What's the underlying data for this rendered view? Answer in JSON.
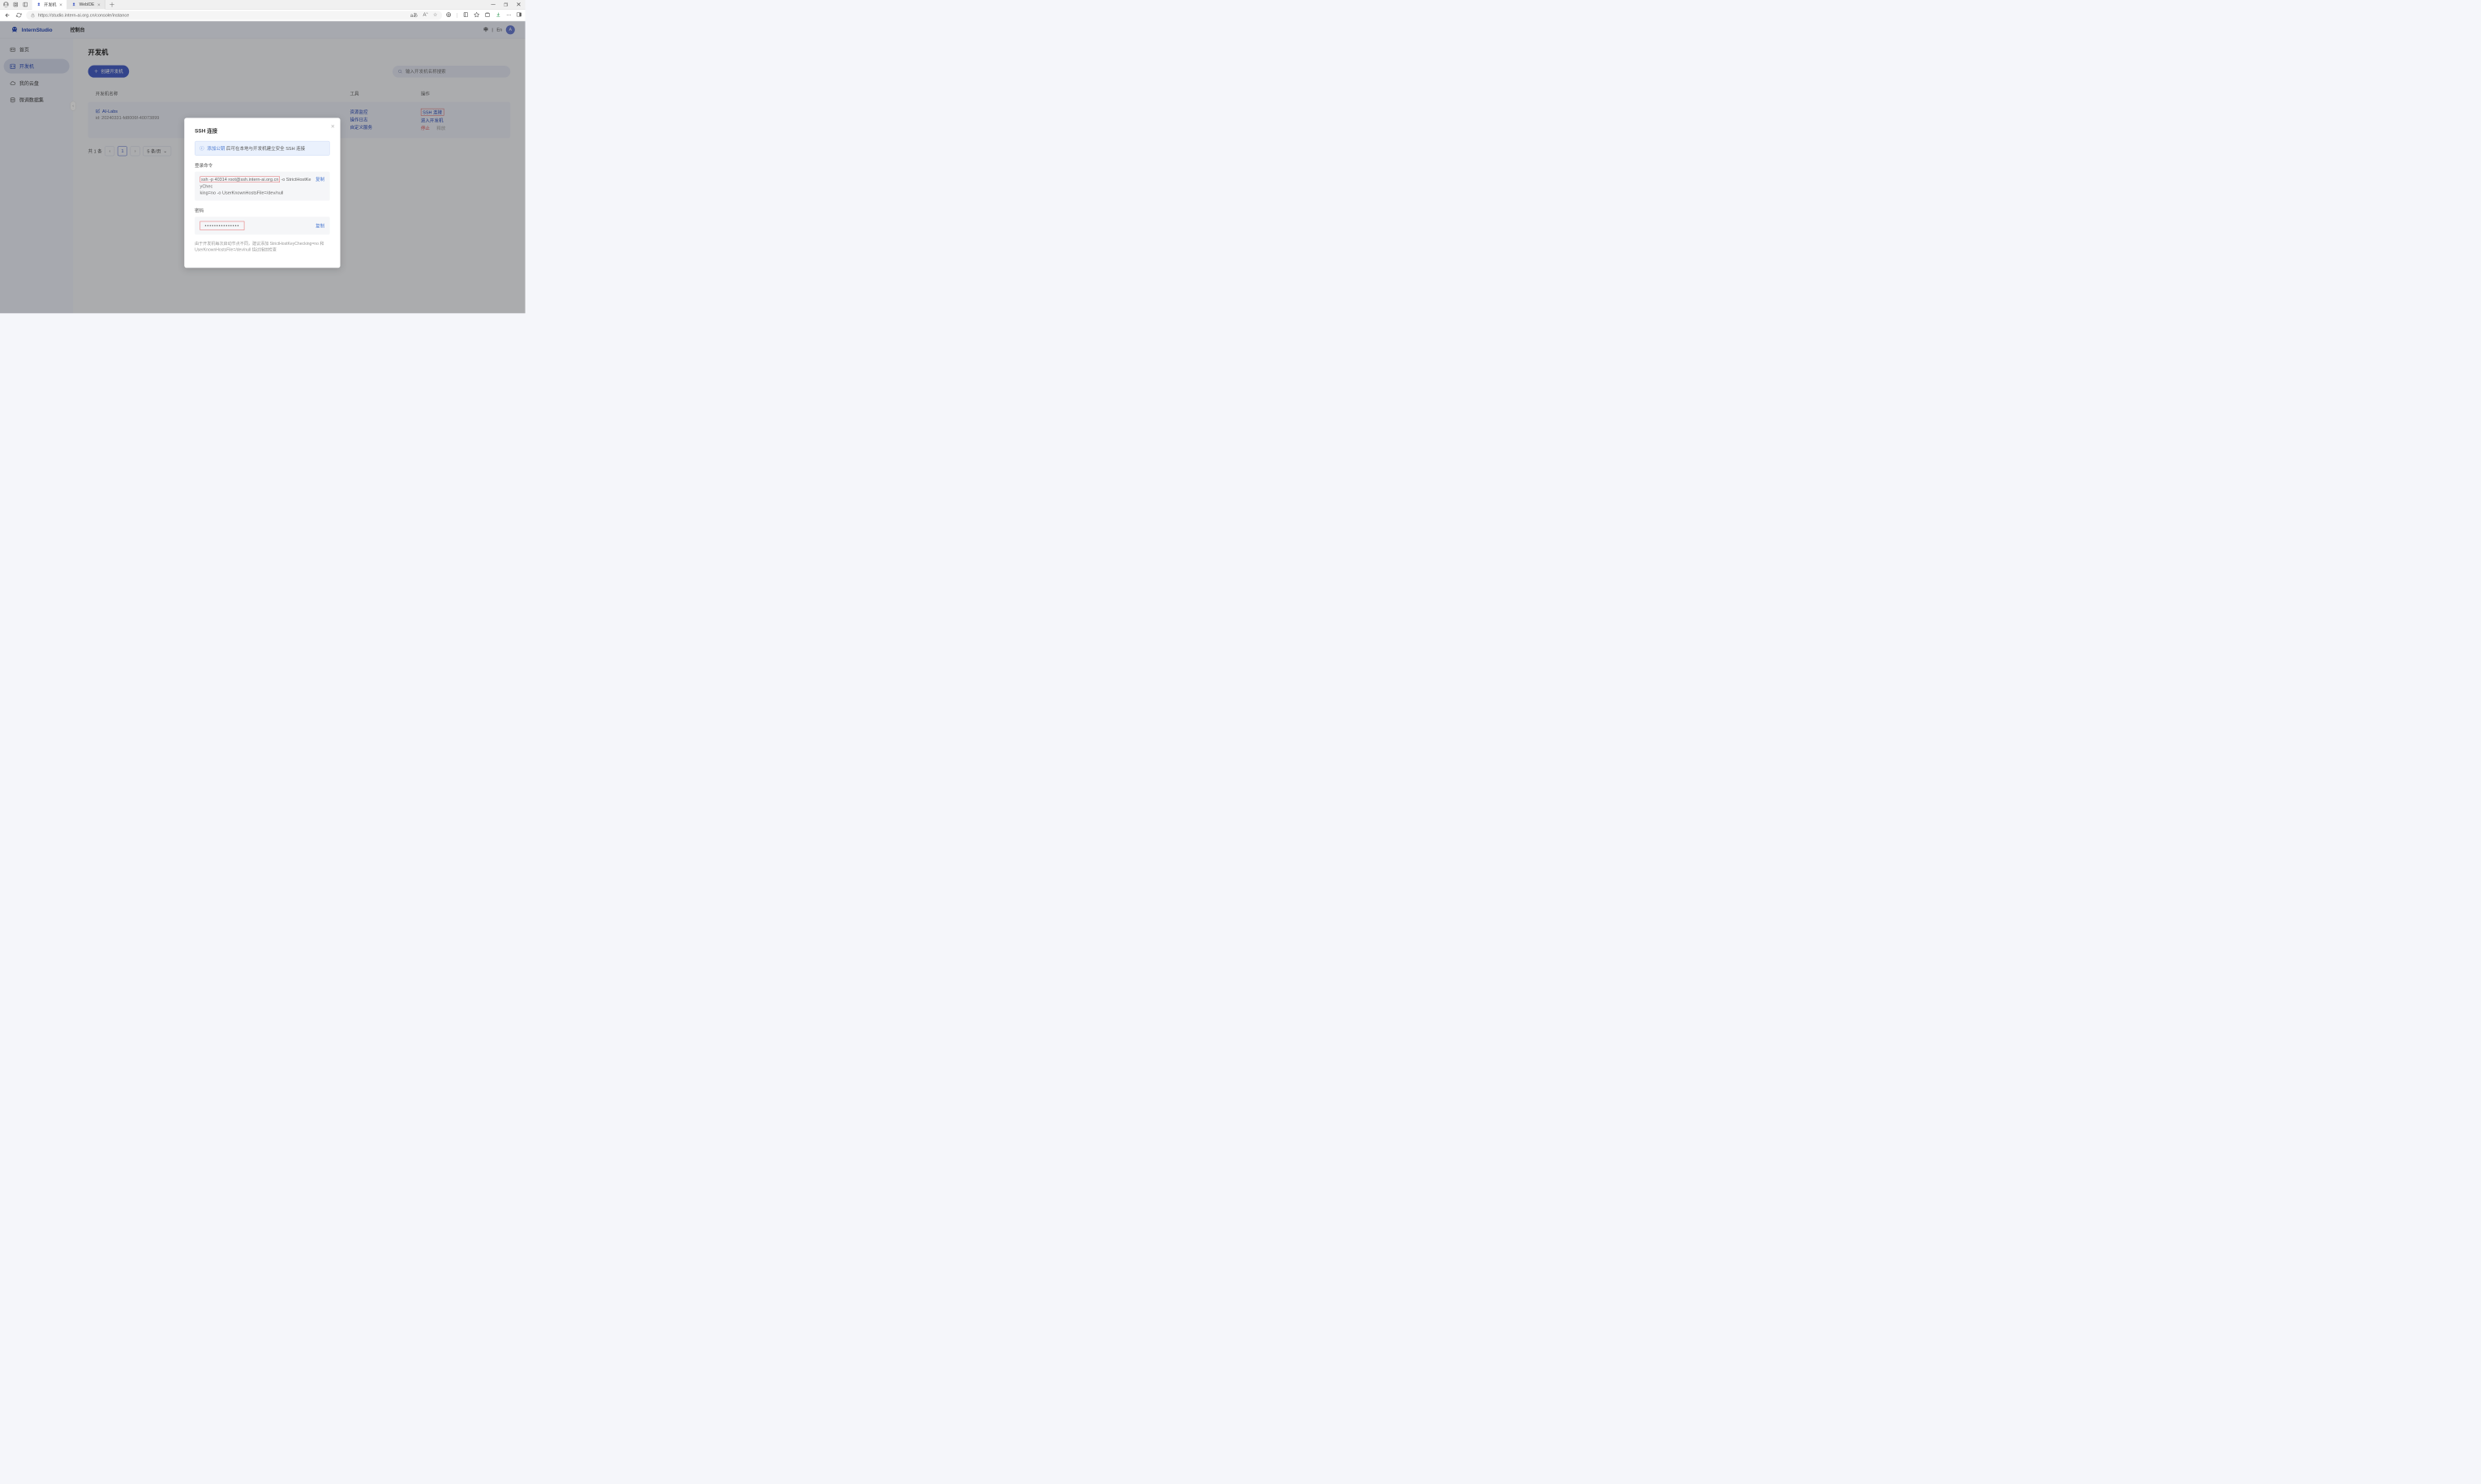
{
  "browser": {
    "tabs": [
      {
        "title": "开发机",
        "active": true
      },
      {
        "title": "WebIDE",
        "active": false
      }
    ],
    "url": "https://studio.intern-ai.org.cn/console/instance",
    "reading_mode": "aあ"
  },
  "app": {
    "brand": "InternStudio",
    "console": "控制台",
    "lang_cn": "中",
    "lang_sep": "|",
    "lang_en": "En",
    "avatar_initial": "A"
  },
  "sidebar": {
    "items": [
      {
        "label": "首页"
      },
      {
        "label": "开发机"
      },
      {
        "label": "我的云盘"
      },
      {
        "label": "微调数据集"
      }
    ]
  },
  "page": {
    "title": "开发机",
    "create_btn": "创建开发机",
    "search_placeholder": "输入开发机名称搜索"
  },
  "table": {
    "headers": {
      "name": "开发机名称",
      "tools": "工具",
      "ops": "操作"
    },
    "row": {
      "name": "AI-Labs",
      "id_label": "id: 20240331-fd8006f-40073899",
      "tools": {
        "monitor": "资源监控",
        "logs": "操作日志",
        "custom": "自定义服务"
      },
      "ops": {
        "ssh": "SSH 连接",
        "enter": "进入开发机",
        "stop": "停止",
        "release": "释放"
      }
    }
  },
  "pager": {
    "total": "共 1 条",
    "page": "1",
    "size": "5 条/页"
  },
  "modal": {
    "title": "SSH 连接",
    "info_link": "添加公钥",
    "info_text": "后可在本地与开发机建立安全 SSH 连接",
    "login_label": "登录命令",
    "cmd_hl": "ssh -p 40314 root@ssh.intern-ai.org.cn",
    "cmd_rest1": " -o StrictHostKeyChec",
    "cmd_rest2": "king=no -o UserKnownHostsFile=/dev/null",
    "copy": "复制",
    "pwd_label": "密码",
    "pwd_masked": "•••••••••••••••",
    "note": "由于开发机每次启动节点不同，建议添加 StrictHostKeyChecking=no 和 UserKnownHostsFile=/dev/null 绕过指纹检查"
  }
}
